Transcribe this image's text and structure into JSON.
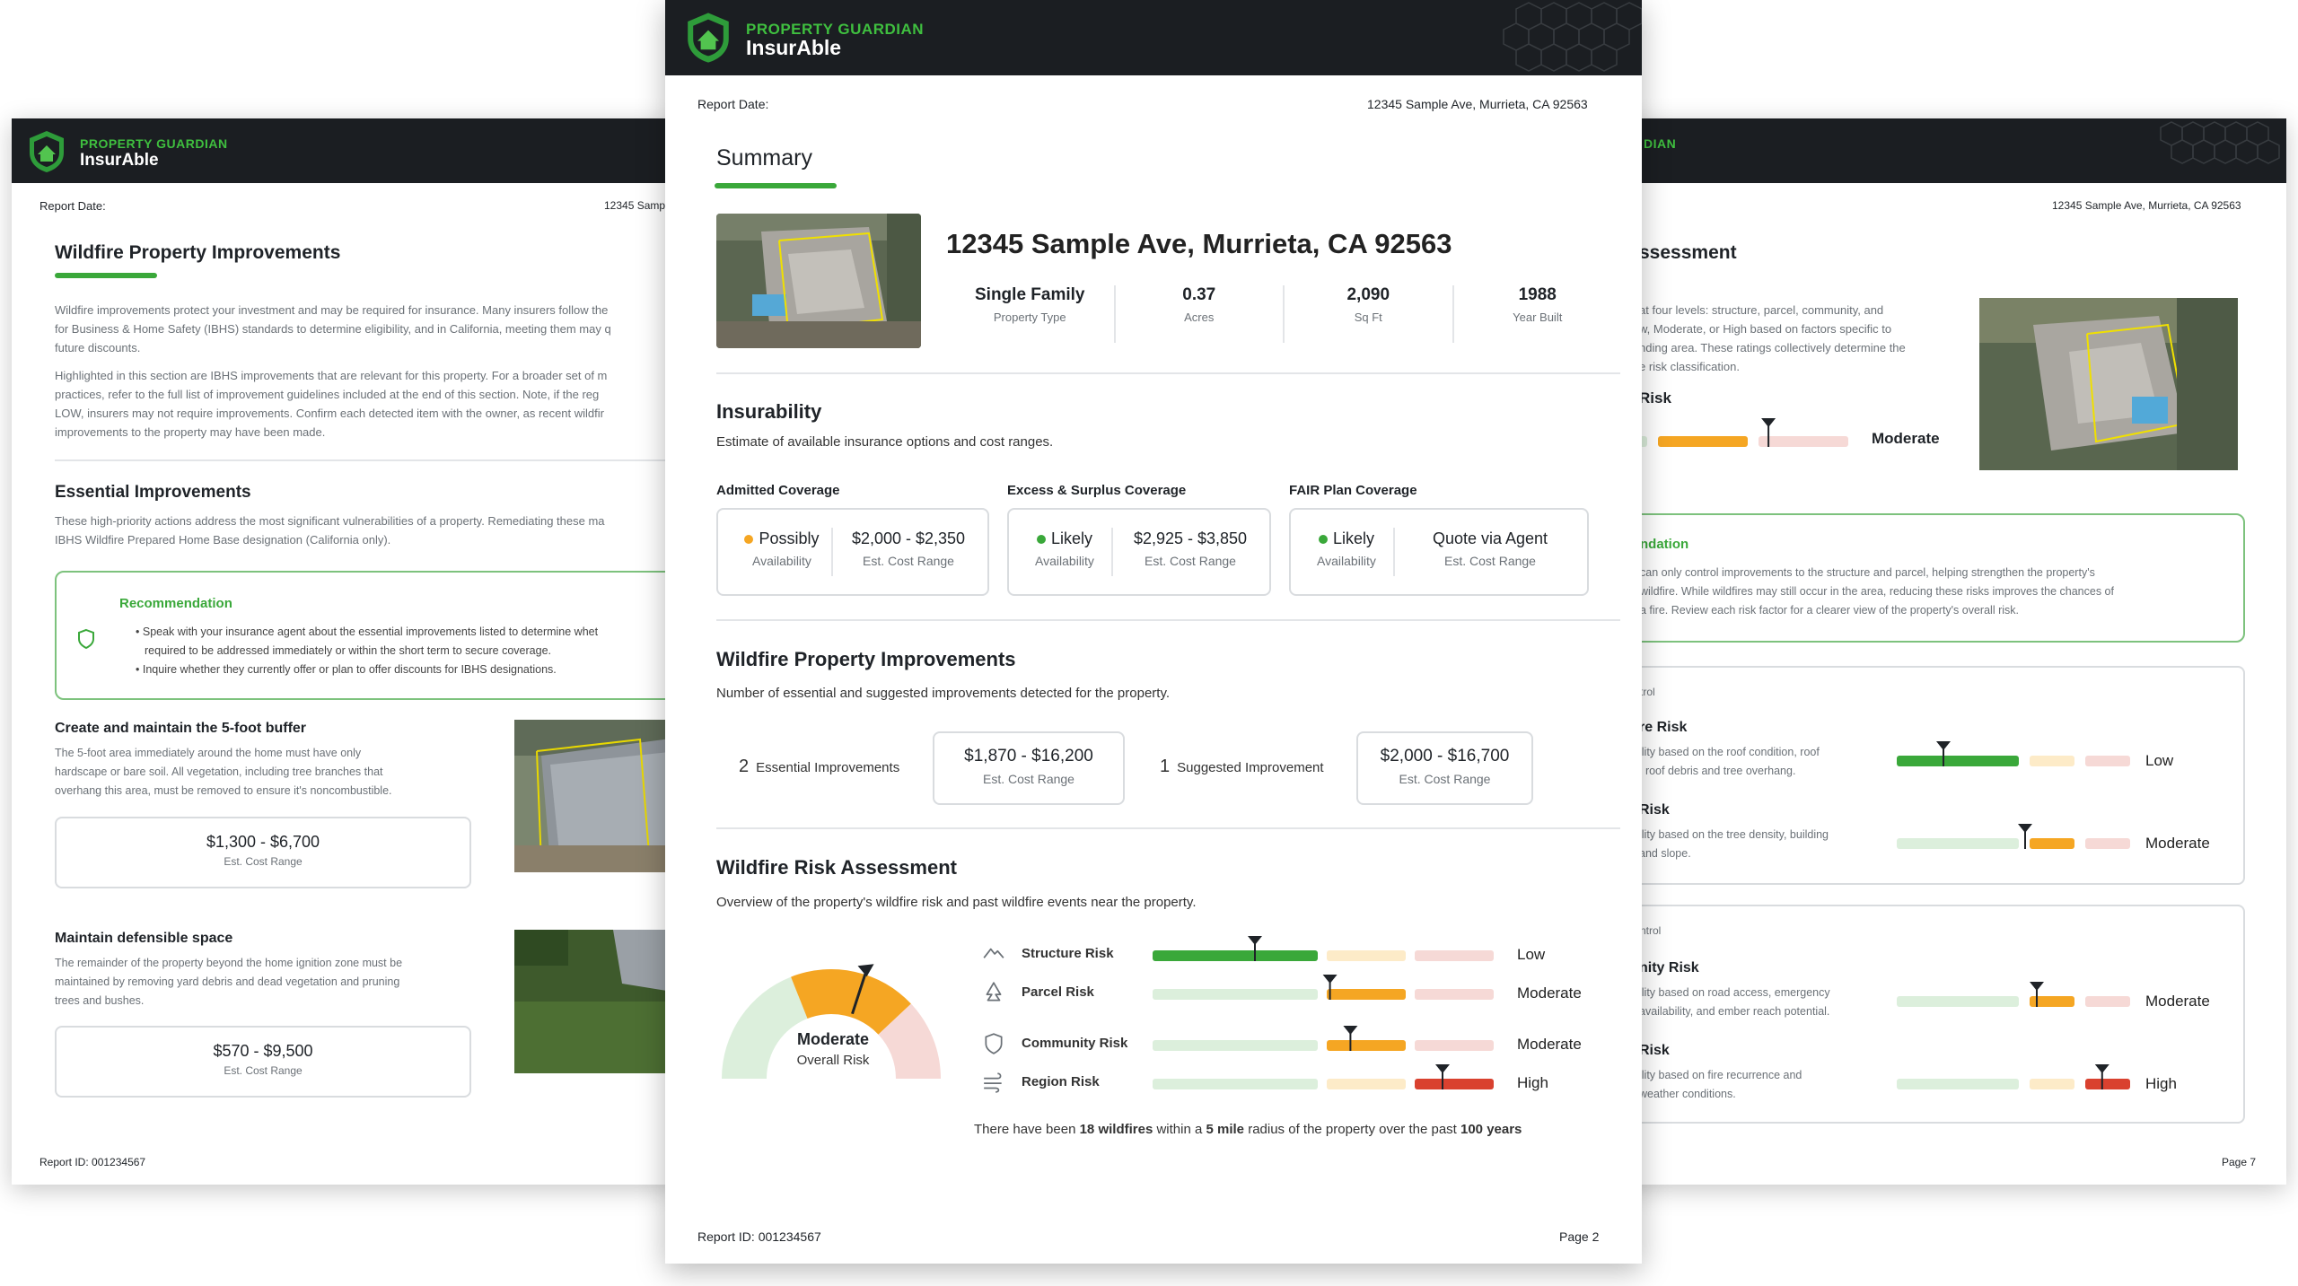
{
  "brand": {
    "top": "PROPERTY GUARDIAN",
    "name": "InsurAble"
  },
  "colors": {
    "green": "#3aa83a",
    "orange": "#f5a623",
    "red": "#d9412f",
    "dark": "#1b1e22",
    "light_green": "#dcefdc",
    "light_orange": "#fdebc8",
    "light_red": "#f6d9d6"
  },
  "center": {
    "report_date_label": "Report Date:",
    "address_top": "12345 Sample Ave, Murrieta, CA 92563",
    "summary_title": "Summary",
    "address": "12345 Sample Ave, Murrieta, CA 92563",
    "stats": [
      {
        "value": "Single Family",
        "label": "Property Type"
      },
      {
        "value": "0.37",
        "label": "Acres"
      },
      {
        "value": "2,090",
        "label": "Sq Ft"
      },
      {
        "value": "1988",
        "label": "Year Built"
      }
    ],
    "insurability_title": "Insurability",
    "insurability_desc": "Estimate of available insurance options and cost ranges.",
    "coverage": [
      {
        "title": "Admitted Coverage",
        "availability": "Possibly",
        "availability_label": "Availability",
        "cost": "$2,000 - $2,350",
        "cost_label": "Est. Cost Range",
        "dot_color": "#f5a623"
      },
      {
        "title": "Excess & Surplus Coverage",
        "availability": "Likely",
        "availability_label": "Availability",
        "cost": "$2,925 - $3,850",
        "cost_label": "Est. Cost Range",
        "dot_color": "#3aa83a"
      },
      {
        "title": "FAIR Plan Coverage",
        "availability": "Likely",
        "availability_label": "Availability",
        "cost": "Quote via Agent",
        "cost_label": "Est. Cost Range",
        "dot_color": "#3aa83a"
      }
    ],
    "improvements_title": "Wildfire Property Improvements",
    "improvements_desc": "Number of essential and suggested improvements detected for the property.",
    "essential_count": "2",
    "essential_label": "Essential Improvements",
    "essential_cost": "$1,870 - $16,200",
    "suggested_count": "1",
    "suggested_label": "Suggested Improvement",
    "suggested_cost": "$2,000 - $16,700",
    "cost_label": "Est. Cost Range",
    "risk_title": "Wildfire Risk Assessment",
    "risk_desc": "Overview of the property's wildfire risk and past wildfire events near the property.",
    "overall_level": "Moderate",
    "overall_label": "Overall Risk",
    "overall_value": 0.6,
    "risks": [
      {
        "name": "Structure Risk",
        "level": "Low",
        "icon": "mountain-icon",
        "value": 0.3
      },
      {
        "name": "Parcel Risk",
        "level": "Moderate",
        "icon": "tree-icon",
        "value": 0.52
      },
      {
        "name": "Community Risk",
        "level": "Moderate",
        "icon": "shield-icon",
        "value": 0.58
      },
      {
        "name": "Region Risk",
        "level": "High",
        "icon": "wind-icon",
        "value": 0.85
      }
    ],
    "history": {
      "pre": "There have been ",
      "count": "18 wildfires",
      "mid": " within a ",
      "radius": "5 mile",
      "mid2": " radius of the property over the past ",
      "years": "100 years"
    },
    "report_id_label": "Report ID:",
    "report_id": "001234567",
    "page": "Page 2"
  },
  "left": {
    "report_date_label": "Report Date:",
    "address_top": "12345 Samp",
    "title": "Wildfire Property Improvements",
    "para1": "Wildfire improvements protect your investment and may be required for insurance. Many insurers follow the",
    "para1b": "for Business & Home Safety (IBHS) standards to determine eligibility, and in California, meeting them may q",
    "para1c": "future discounts.",
    "para2": "Highlighted in this section are IBHS improvements that are relevant for this property. For a broader set of m",
    "para2b": "practices, refer to the full list of improvement guidelines included at the end of this section. Note, if the reg",
    "para2c": "LOW, insurers may not require improvements. Confirm each detected item with the owner, as recent wildfir",
    "para2d": "improvements to the property may have been made.",
    "essential_title": "Essential Improvements",
    "essential_desc": "These high-priority actions address the most significant vulnerabilities of a property. Remediating these ma",
    "essential_desc2": "IBHS Wildfire Prepared Home Base designation (California only).",
    "rec_title": "Recommendation",
    "rec_items": [
      "Speak with your insurance agent about the essential improvements listed to determine whet",
      "required to be addressed immediately or within the short term to secure coverage.",
      "Inquire whether they currently offer or plan to offer discounts for IBHS designations."
    ],
    "item1_title": "Create and maintain the 5-foot buffer",
    "item1_desc1": "The 5-foot area immediately around the home must have only",
    "item1_desc2": "hardscape or bare soil. All vegetation, including tree branches that",
    "item1_desc3": "overhang this area, must be removed to ensure it's noncombustible.",
    "item1_cost": "$1,300 - $6,700",
    "item2_title": "Maintain defensible space",
    "item2_desc1": "The remainder of the property beyond the home ignition zone must be",
    "item2_desc2": "maintained by removing yard debris and dead vegetation and pruning",
    "item2_desc3": "trees and bushes.",
    "item2_cost": "$570 - $9,500",
    "cost_label": "Est. Cost Range",
    "report_id_label": "Report ID:",
    "report_id": "001234567"
  },
  "right": {
    "brand_fragment": "DIAN",
    "address_top": "12345 Sample Ave, Murrieta, CA 92563",
    "title_fragment": "ssessment",
    "desc1": "at four levels: structure, parcel, community, and",
    "desc2": "w, Moderate, or High based on factors specific to",
    "desc3": "nding area. These ratings collectively determine the",
    "desc4": "e risk classification.",
    "risk_fragment": "Risk",
    "overall_level": "Moderate",
    "overall_value": 0.62,
    "rec_fragment": "ndation",
    "rec1": "can only control improvements to the structure and parcel, helping strengthen the property's",
    "rec2": "wildfire. While wildfires may still occur in the area, reducing these risks improves the chances of",
    "rec3": "a fire. Review each risk factor for a clearer view of the property's overall risk.",
    "group1_label": "trol",
    "group2_label": "ntrol",
    "items": [
      {
        "title": "re Risk",
        "d1": "ility based on the roof condition, roof",
        "d2": ", roof debris and tree overhang.",
        "level": "Low",
        "value": 0.2
      },
      {
        "title": "Risk",
        "d1": "ility based on the tree density, building",
        "d2": "and slope.",
        "level": "Moderate",
        "value": 0.55
      },
      {
        "title": "nity Risk",
        "d1": "ility based on road access, emergency",
        "d2": "availability, and ember reach potential.",
        "level": "Moderate",
        "value": 0.6
      },
      {
        "title": "Risk",
        "d1": "ility based on fire recurrence and",
        "d2": "weather conditions.",
        "level": "High",
        "value": 0.88
      }
    ],
    "page": "Page 7"
  }
}
